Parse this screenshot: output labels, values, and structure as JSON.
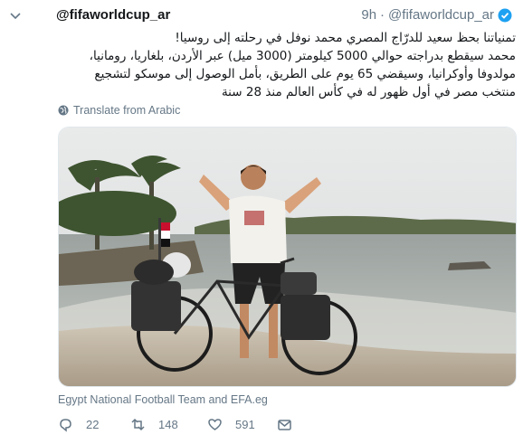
{
  "tweet": {
    "account_name": "@fifaworldcup_ar",
    "handle": "@fifaworldcup_ar",
    "separator": "·",
    "time": "9h",
    "text_lines": [
      "تمنياتنا بحظ سعيد للدرّاج المصري محمد نوفل في رحلته إلى روسيا!",
      "محمد سيقطع بدراجته حوالي 5000 كيلومتر (3000 ميل) عبر الأردن، بلغاريا، رومانيا،",
      "مولدوفا وأوكرانيا، وسيقضي 65 يوم على الطريق، بأمل الوصول إلى موسكو لتشجيع",
      "منتخب مصر في أول ظهور له في كأس العالم منذ 28 سنة"
    ],
    "translate_label": "Translate from Arabic",
    "media_credit": "Egypt National Football Team and EFA.eg",
    "replies": "22",
    "retweets": "148",
    "likes": "591"
  },
  "icons": {
    "verified": "verified-badge-icon",
    "chevron": "chevron-down-icon",
    "globe": "globe-icon",
    "reply": "reply-icon",
    "retweet": "retweet-icon",
    "like": "heart-icon",
    "message": "envelope-icon"
  },
  "colors": {
    "verified_blue": "#1da1f2",
    "secondary_text": "#657786",
    "primary_text": "#14171a"
  }
}
